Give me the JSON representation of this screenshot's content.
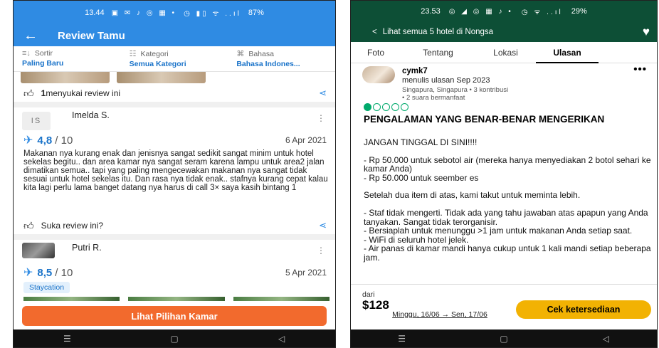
{
  "left": {
    "status": {
      "time": "13.44",
      "icons": "▣ ✉ ♪ ◎ ▦ •",
      "right_icons": "◷ ▮▯ ᯤ ..ıl",
      "battery": "87%"
    },
    "appbar": {
      "back": "←",
      "title": "Review Tamu"
    },
    "filters": [
      {
        "label": "Sortir",
        "value": "Paling Baru",
        "icon": "≡↓"
      },
      {
        "label": "Kategori",
        "value": "Semua Kategori",
        "icon": "☷"
      },
      {
        "label": "Bahasa",
        "value": "Bahasa Indones...",
        "icon": "⌘"
      }
    ],
    "like_row_1": {
      "count": "1",
      "text": " menyukai review ini"
    },
    "review_1": {
      "initials": "IS",
      "name": "Imelda S.",
      "score": "4,8",
      "out_of": "/ 10",
      "date": "6 Apr 2021",
      "text": "Makanan nya kurang enak dan jenisnya sangat sedikit sangat minim untuk hotel sekelas begitu.. dan area kamar nya sangat seram karena lampu untuk area2 jalan dimatikan semua.. tapi yang paling mengecewakan makanan nya sangat tidak sesuai untuk hotel sekelas itu. Dan rasa nya tidak enak.. stafnya kurang cepat kalau kita lagi perlu lama banget datang nya harus di call 3× saya kasih bintang 1"
    },
    "like_row_2": {
      "text": "Suka review ini?"
    },
    "review_2": {
      "name": "Putri R.",
      "score": "8,5",
      "out_of": "/ 10",
      "date": "5 Apr 2021",
      "tag": "Staycation"
    },
    "cta": "Lihat Pilihan Kamar",
    "nav": [
      "☰",
      "▢",
      "◁"
    ]
  },
  "right": {
    "status": {
      "time": "23.53",
      "icons": "◎ ◢ ◎ ▦ ♪ •",
      "right_icons": "◷ ᯤ ..ıl",
      "battery": "29%"
    },
    "appbar": {
      "back": "<",
      "title": "Lihat semua 5 hotel di Nongsa",
      "heart": "♥"
    },
    "tabs": [
      "Foto",
      "Tentang",
      "Lokasi",
      "Ulasan"
    ],
    "active_tab": "Ulasan",
    "review": {
      "user": "cymk7",
      "meta1": "menulis ulasan Sep 2023",
      "meta2": "Singapura, Singapura • 3 kontribusi",
      "meta3": "• 2 suara bermanfaat",
      "rating": 1,
      "rating_max": 5,
      "title": "PENGALAMAN YANG BENAR-BENAR MENGERIKAN",
      "paragraphs": [
        "JANGAN TINGGAL DI SINI!!!!",
        "- Rp 50.000 untuk sebotol air (mereka hanya menyediakan 2 botol sehari ke kamar Anda)\n- Rp 50.000 untuk seember es",
        "Setelah dua item di atas, kami takut untuk meminta lebih.",
        "- Staf tidak mengerti. Tidak ada yang tahu jawaban atas apapun yang Anda tanyakan. Sangat tidak terorganisir.\n- Bersiaplah untuk menunggu >1 jam untuk makanan Anda setiap saat.\n- WiFi di seluruh hotel jelek.\n- Air panas di kamar mandi hanya cukup untuk 1 kali mandi setiap beberapa jam."
      ]
    },
    "bottom": {
      "from": "dari",
      "price": "$128",
      "dates": "Minggu, 16/06 → Sen, 17/06",
      "check": "Cek ketersediaan"
    },
    "nav": [
      "☰",
      "▢",
      "◁"
    ],
    "colors": {
      "header": "#0d4f36",
      "bubble": "#00aa6c",
      "check_button": "#f2b203"
    }
  },
  "colors": {
    "left_header": "#2f8be3",
    "cta": "#f26a2d"
  }
}
